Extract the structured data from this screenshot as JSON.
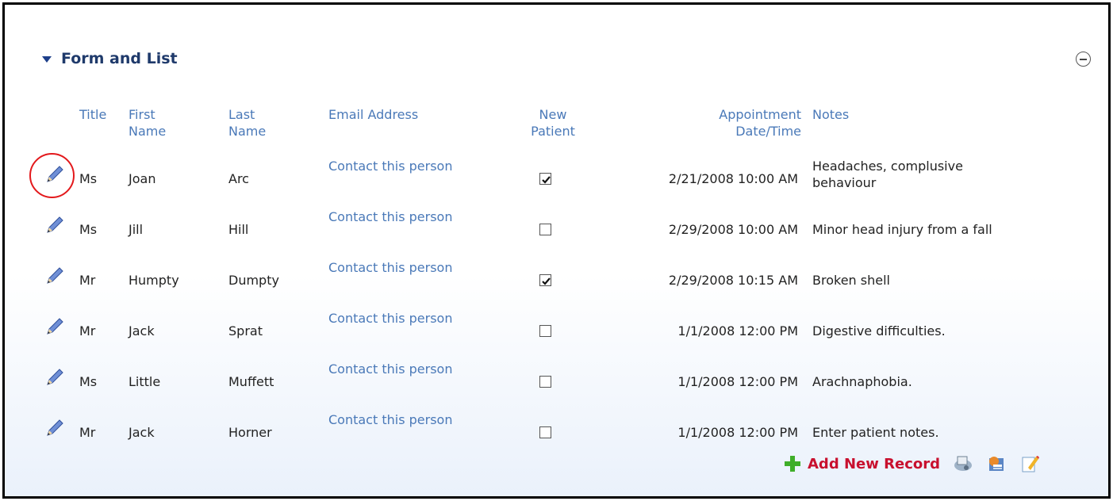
{
  "panel": {
    "title": "Form and List"
  },
  "columns": {
    "title": "Title",
    "first_name": "First Name",
    "last_name": "Last Name",
    "email": "Email Address",
    "new_patient": "New Patient",
    "appointment": "Appointment Date/Time",
    "notes": "Notes"
  },
  "rows": [
    {
      "title": "Ms",
      "first": "Joan",
      "last": "Arc",
      "email": "Contact this person",
      "new_patient": true,
      "appointment": "2/21/2008 10:00 AM",
      "notes": "Headaches, complusive behaviour"
    },
    {
      "title": "Ms",
      "first": "Jill",
      "last": "Hill",
      "email": "Contact this person",
      "new_patient": false,
      "appointment": "2/29/2008 10:00 AM",
      "notes": "Minor head injury from a fall"
    },
    {
      "title": "Mr",
      "first": "Humpty",
      "last": "Dumpty",
      "email": "Contact this person",
      "new_patient": true,
      "appointment": "2/29/2008 10:15 AM",
      "notes": "Broken shell"
    },
    {
      "title": "Mr",
      "first": "Jack",
      "last": "Sprat",
      "email": "Contact this person",
      "new_patient": false,
      "appointment": "1/1/2008 12:00 PM",
      "notes": "Digestive difficulties."
    },
    {
      "title": "Ms",
      "first": "Little",
      "last": "Muffett",
      "email": "Contact this person",
      "new_patient": false,
      "appointment": "1/1/2008 12:00 PM",
      "notes": "Arachnaphobia."
    },
    {
      "title": "Mr",
      "first": "Jack",
      "last": "Horner",
      "email": "Contact this person",
      "new_patient": false,
      "appointment": "1/1/2008 12:00 PM",
      "notes": "Enter patient notes."
    }
  ],
  "footer": {
    "add_label": "Add New Record"
  },
  "icons": {
    "edit": "pencil-icon",
    "add": "plus-icon",
    "collapse": "minus-circle-icon"
  }
}
